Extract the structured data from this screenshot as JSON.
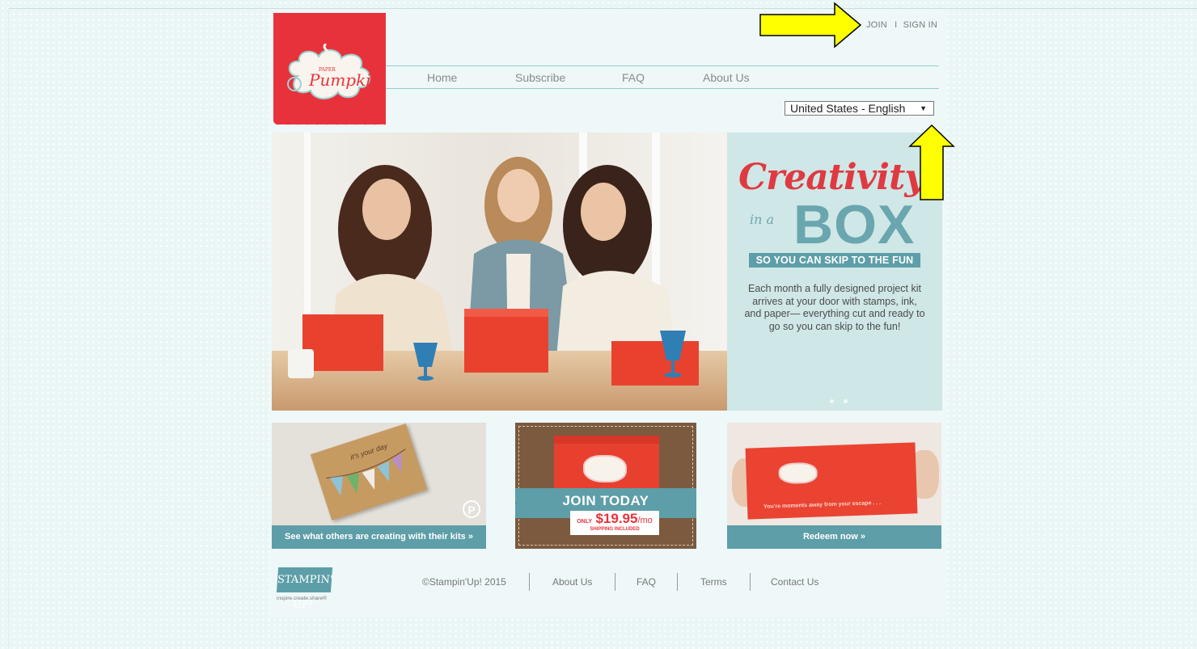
{
  "header": {
    "logo_alt": "Paper Pumpkin",
    "auth": {
      "join": "JOIN",
      "separator": "I",
      "sign_in": "SIGN IN"
    },
    "nav": [
      {
        "label": "Home"
      },
      {
        "label": "Subscribe"
      },
      {
        "label": "FAQ"
      },
      {
        "label": "About Us"
      }
    ],
    "language_select": {
      "selected": "United States - English"
    }
  },
  "hero": {
    "headline": "Creativity",
    "in_a": "in a",
    "box": "BOX",
    "band": "SO YOU CAN SKIP TO THE FUN",
    "description": "Each month a fully designed project kit arrives at your door with stamps, ink, and paper— everything cut and ready to go so you can skip to the fun!",
    "slide_count": 2
  },
  "promos": [
    {
      "bar": "See what others are creating with their kits »",
      "card_text": "it's your day"
    },
    {
      "ribbon": "JOIN TODAY",
      "price_only": "ONLY",
      "price": "$19.95",
      "price_unit": "/mo",
      "price_sub": "SHIPPING INCLUDED"
    },
    {
      "bar": "Redeem now »",
      "box_text": "You're moments away from your escape . . ."
    }
  ],
  "footer": {
    "logo_text": "STAMPIN' UP!",
    "tagline": "inspire.create.share®",
    "copyright": "©Stampin'Up! 2015",
    "links": [
      "About Us",
      "FAQ",
      "Terms",
      "Contact Us"
    ]
  },
  "colors": {
    "brand_red": "#e8323b",
    "teal": "#5d9ea8",
    "nav_line": "#8fcfcb",
    "annotation_yellow": "#ffff00"
  },
  "annotations": [
    "yellow-arrow-right",
    "yellow-arrow-up"
  ]
}
